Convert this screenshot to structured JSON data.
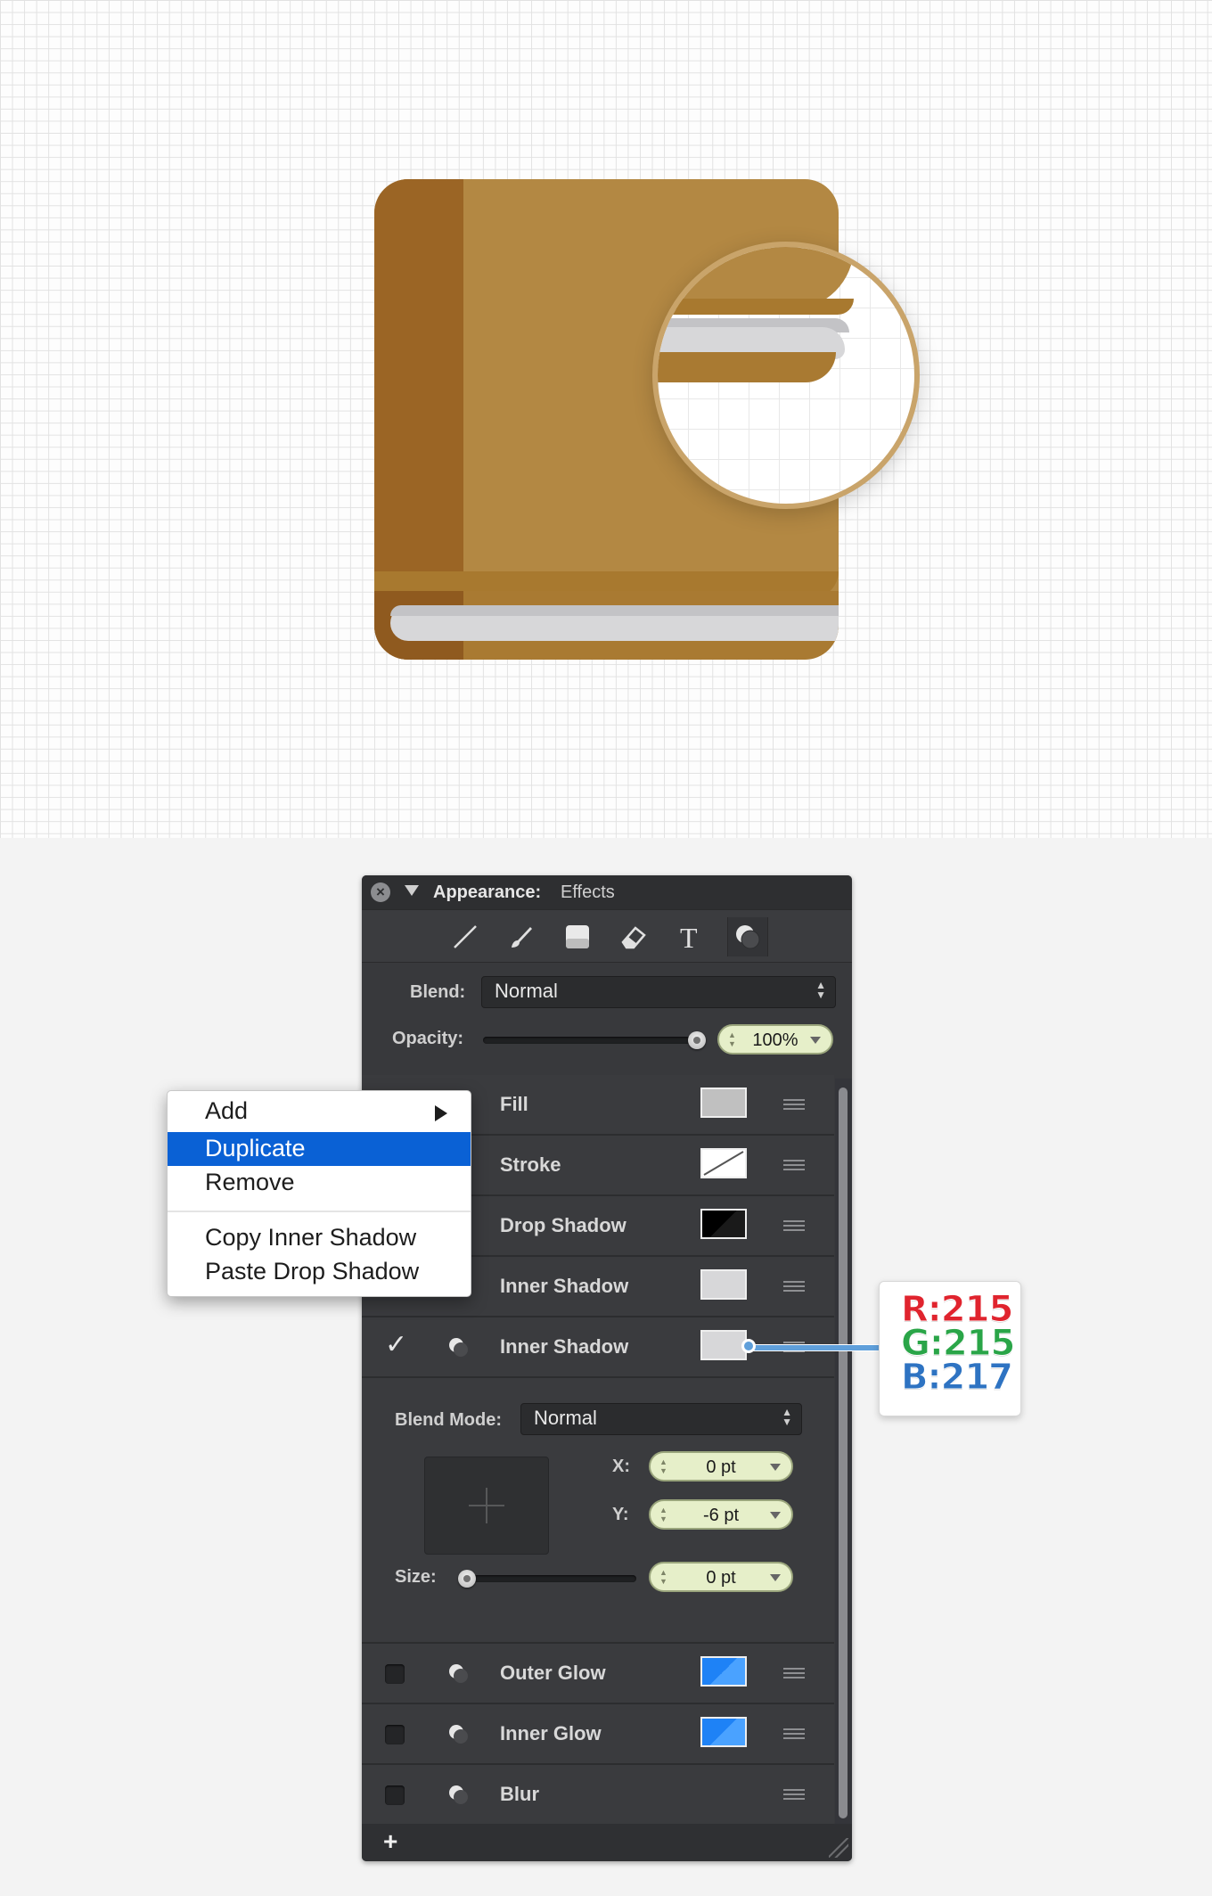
{
  "panel": {
    "title": "Appearance:",
    "subtitle": "Effects",
    "tools": [
      "line-tool-icon",
      "brush-icon",
      "fill-square-icon",
      "eraser-icon",
      "text-tool-icon",
      "effects-icon"
    ],
    "blend_label": "Blend:",
    "blend_value": "Normal",
    "opacity_label": "Opacity:",
    "opacity_value": "100%",
    "opacity_level": 1.0,
    "layers": [
      {
        "name": "Fill",
        "checked": false,
        "swatch": "#c0c0c0"
      },
      {
        "name": "Stroke",
        "checked": true,
        "swatch": "none"
      },
      {
        "name": "Drop Shadow",
        "checked": false,
        "swatch": "#000000"
      },
      {
        "name": "Inner Shadow",
        "checked": false,
        "swatch": "#d7d7d9"
      },
      {
        "name": "Inner Shadow",
        "checked": true,
        "swatch": "#d7d7d9"
      },
      {
        "name": "Outer Glow",
        "checked": false,
        "swatch": "#1e82f6"
      },
      {
        "name": "Inner Glow",
        "checked": false,
        "swatch": "#1e82f6"
      },
      {
        "name": "Blur",
        "checked": false,
        "swatch": ""
      }
    ],
    "detail": {
      "blend_mode_label": "Blend Mode:",
      "blend_mode_value": "Normal",
      "x_label": "X:",
      "x_value": "0 pt",
      "y_label": "Y:",
      "y_value": "-6 pt",
      "size_label": "Size:",
      "size_value": "0 pt",
      "size_level": 0.0
    },
    "add_label": "+"
  },
  "context_menu": {
    "items": [
      "Add",
      "Duplicate",
      "Remove",
      "Copy Inner Shadow",
      "Paste Drop Shadow"
    ],
    "highlighted": "Duplicate"
  },
  "callout": {
    "r": "R:215",
    "g": "G:215",
    "b": "B:217",
    "colors": {
      "r": "#e0242e",
      "g": "#2aa548",
      "b": "#2e73c2"
    }
  },
  "colors": {
    "book_cover": "#b38843",
    "book_spine": "#9b6525",
    "pages": "#d7d7d9",
    "panel_bg": "#38393c",
    "menu_highlight": "#0a61d5"
  }
}
